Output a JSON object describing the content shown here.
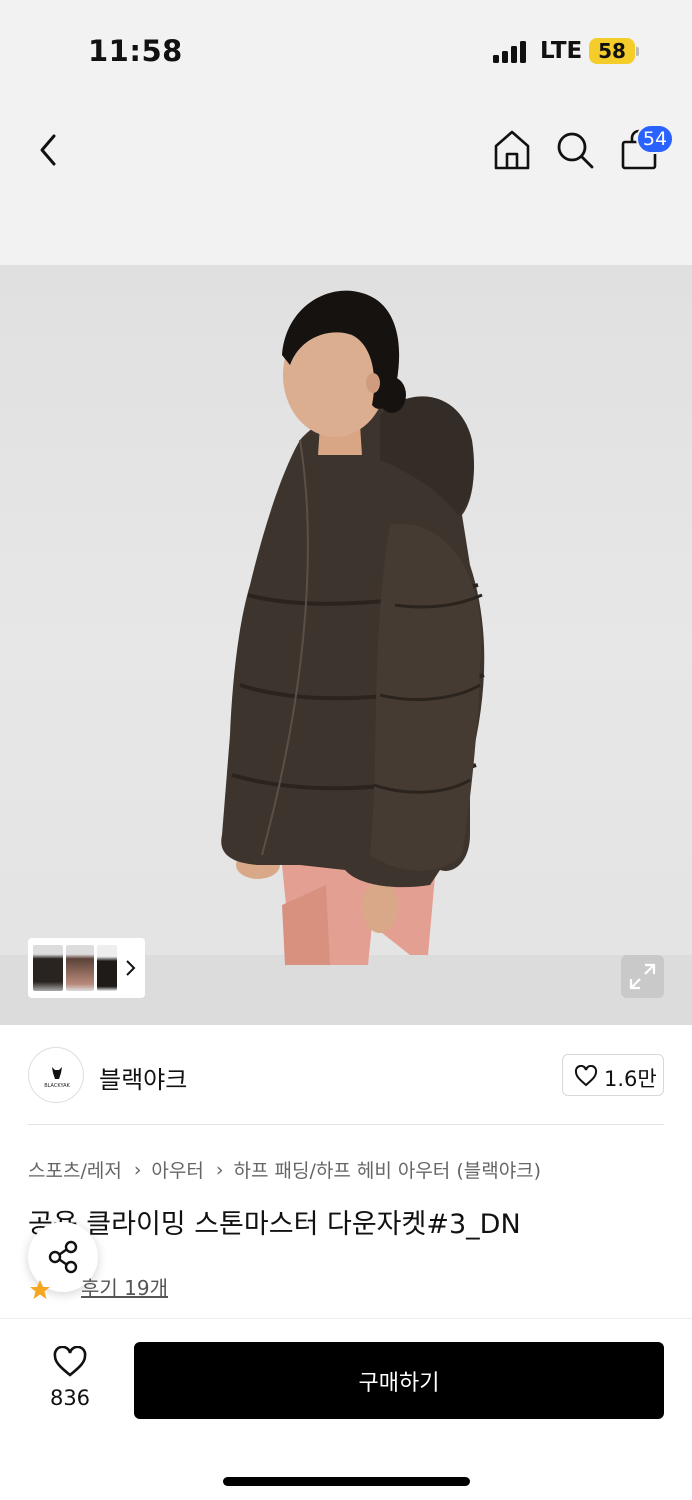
{
  "status_bar": {
    "time": "11:58",
    "network": "LTE",
    "battery": "58",
    "battery_color": "#f5cd2b"
  },
  "nav": {
    "back_icon": "chevron-left-icon",
    "home_icon": "home-icon",
    "search_icon": "search-icon",
    "cart_icon": "shopping-bag-icon",
    "cart_count": "54",
    "badge_color": "#2962ff"
  },
  "gallery": {
    "expand_icon": "expand-icon",
    "thumb_chevron_icon": "chevron-right-icon"
  },
  "brand": {
    "name": "블랙야크",
    "logo_text": "BLACKYAK",
    "like_count": "1.6만"
  },
  "breadcrumb": [
    "스포츠/레저",
    "아우터",
    "하프 패딩/하프 헤비 아우터 (블랙야크)"
  ],
  "product": {
    "title": "공용 클라이밍 스톤마스터 다운자켓#3_DN",
    "review_label": "후기 19개",
    "rating_icon": "star-icon",
    "rating_color": "#f5a623"
  },
  "bottom_bar": {
    "wish_count": "836",
    "buy_label": "구매하기",
    "buy_color": "#000000"
  }
}
